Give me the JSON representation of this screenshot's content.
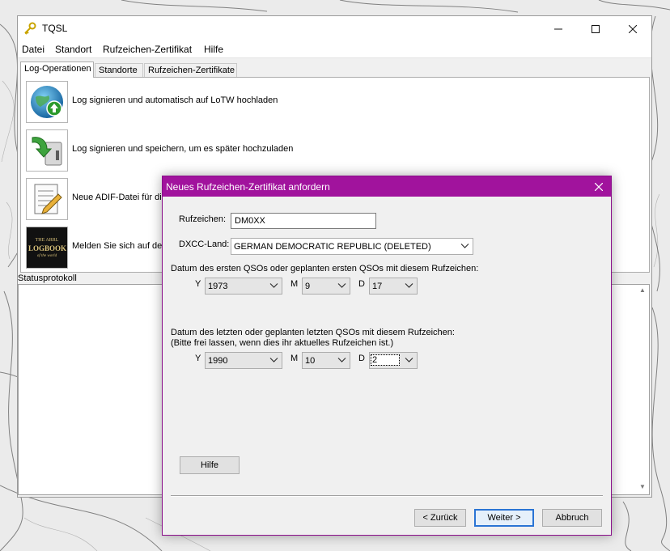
{
  "window": {
    "title": "TQSL",
    "menu": [
      "Datei",
      "Standort",
      "Rufzeichen-Zertifikat",
      "Hilfe"
    ],
    "tabs": [
      "Log-Operationen",
      "Standorte",
      "Rufzeichen-Zertifikate"
    ],
    "operations": [
      {
        "label": "Log signieren und automatisch auf LoTW hochladen",
        "icon": "globe-upload-icon"
      },
      {
        "label": "Log signieren und speichern, um es später hochzuladen",
        "icon": "save-arrow-icon"
      },
      {
        "label": "Neue ADIF-Datei für die",
        "icon": "edit-document-icon"
      },
      {
        "label": "Melden Sie sich auf der L",
        "icon": "logbook-logo-icon"
      }
    ],
    "logbook_logo_text": {
      "top": "THE ARRL",
      "main": "LOGBOOK",
      "sub": "of the world"
    },
    "status_label": "Statusprotokoll"
  },
  "dialog": {
    "title": "Neues Rufzeichen-Zertifikat anfordern",
    "callsign_label": "Rufzeichen:",
    "callsign_value": "DM0XX",
    "dxcc_label": "DXCC-Land:",
    "dxcc_value": "GERMAN DEMOCRATIC REPUBLIC (DELETED)",
    "first_qso_label": "Datum des ersten QSOs oder geplanten ersten QSOs mit diesem Rufzeichen:",
    "last_qso_label_1": "Datum des letzten oder geplanten letzten QSOs mit diesem Rufzeichen:",
    "last_qso_label_2": "(Bitte frei lassen, wenn dies ihr aktuelles Rufzeichen ist.)",
    "y_label": "Y",
    "m_label": "M",
    "d_label": "D",
    "first_date": {
      "y": "1973",
      "m": "9",
      "d": "17"
    },
    "last_date": {
      "y": "1990",
      "m": "10",
      "d": "2"
    },
    "help_button": "Hilfe",
    "back_button": "< Zurück",
    "next_button": "Weiter >",
    "cancel_button": "Abbruch"
  },
  "colors": {
    "dialog_title_bar": "#a1139d",
    "default_button_border": "#2a74d4"
  }
}
